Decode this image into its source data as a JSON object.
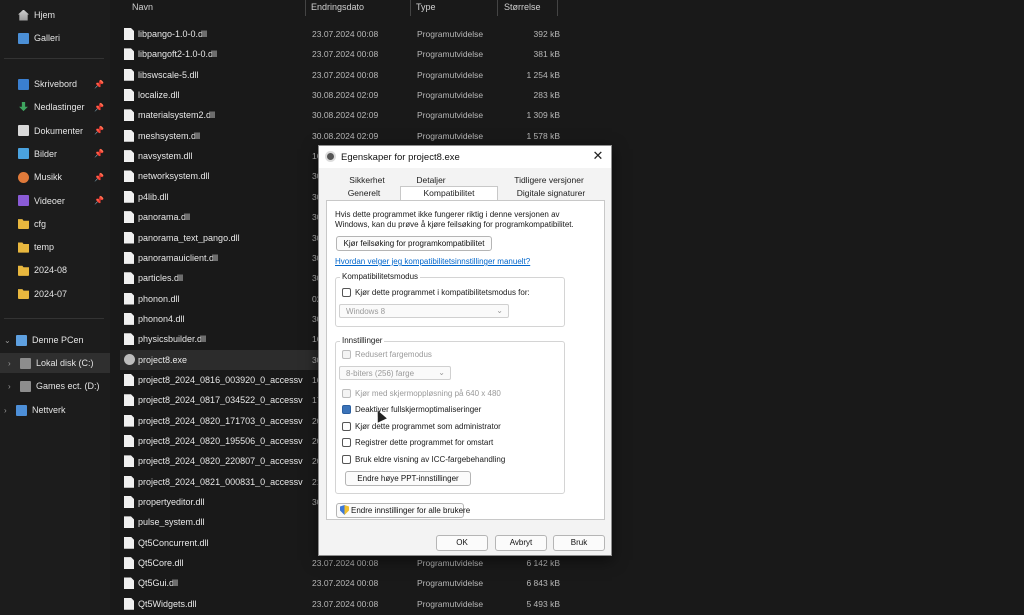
{
  "nav": {
    "quick": [
      {
        "label": "Hjem",
        "icon": "home-icon"
      },
      {
        "label": "Galleri",
        "icon": "gallery-icon"
      }
    ],
    "pinned": [
      {
        "label": "Skrivebord",
        "icon": "desktop-icon",
        "pinned": true
      },
      {
        "label": "Nedlastinger",
        "icon": "downloads-icon",
        "pinned": true
      },
      {
        "label": "Dokumenter",
        "icon": "documents-icon",
        "pinned": true
      },
      {
        "label": "Bilder",
        "icon": "pictures-icon",
        "pinned": true
      },
      {
        "label": "Musikk",
        "icon": "music-icon",
        "pinned": true
      },
      {
        "label": "Videoer",
        "icon": "videos-icon",
        "pinned": true
      },
      {
        "label": "cfg",
        "icon": "folder-icon",
        "pinned": false
      },
      {
        "label": "temp",
        "icon": "folder-icon",
        "pinned": false
      },
      {
        "label": "2024-08",
        "icon": "folder-icon",
        "pinned": false
      },
      {
        "label": "2024-07",
        "icon": "folder-icon",
        "pinned": false
      }
    ],
    "tree": [
      {
        "label": "Denne PCen",
        "icon": "pc-icon",
        "chevron": "⌄"
      },
      {
        "label": "Lokal disk (C:)",
        "icon": "drive-icon",
        "chevron": "›"
      },
      {
        "label": "Games ect. (D:)",
        "icon": "drive-icon",
        "chevron": "›"
      },
      {
        "label": "Nettverk",
        "icon": "network-icon",
        "chevron": "›"
      }
    ],
    "pin_glyph": "📌"
  },
  "files": {
    "columns": {
      "name": "Navn",
      "date": "Endringsdato",
      "type": "Type",
      "size": "Størrelse"
    },
    "rows": [
      {
        "name": "libpango-1.0-0.dll",
        "date": "23.07.2024 00:08",
        "type": "Programutvidelse",
        "size": "392 kB"
      },
      {
        "name": "libpangoft2-1.0-0.dll",
        "date": "23.07.2024 00:08",
        "type": "Programutvidelse",
        "size": "381 kB"
      },
      {
        "name": "libswscale-5.dll",
        "date": "23.07.2024 00:08",
        "type": "Programutvidelse",
        "size": "1 254 kB"
      },
      {
        "name": "localize.dll",
        "date": "30.08.2024 02:09",
        "type": "Programutvidelse",
        "size": "283 kB"
      },
      {
        "name": "materialsystem2.dll",
        "date": "30.08.2024 02:09",
        "type": "Programutvidelse",
        "size": "1 309 kB"
      },
      {
        "name": "meshsystem.dll",
        "date": "30.08.2024 02:09",
        "type": "Programutvidelse",
        "size": "1 578 kB"
      },
      {
        "name": "navsystem.dll",
        "date": "16",
        "type": "",
        "size": ""
      },
      {
        "name": "networksystem.dll",
        "date": "30",
        "type": "",
        "size": ""
      },
      {
        "name": "p4lib.dll",
        "date": "30",
        "type": "",
        "size": ""
      },
      {
        "name": "panorama.dll",
        "date": "30",
        "type": "",
        "size": ""
      },
      {
        "name": "panorama_text_pango.dll",
        "date": "30",
        "type": "",
        "size": ""
      },
      {
        "name": "panoramauiclient.dll",
        "date": "30",
        "type": "",
        "size": ""
      },
      {
        "name": "particles.dll",
        "date": "30",
        "type": "",
        "size": ""
      },
      {
        "name": "phonon.dll",
        "date": "02",
        "type": "",
        "size": ""
      },
      {
        "name": "phonon4.dll",
        "date": "30",
        "type": "",
        "size": ""
      },
      {
        "name": "physicsbuilder.dll",
        "date": "16",
        "type": "",
        "size": ""
      },
      {
        "name": "project8.exe",
        "date": "30",
        "type": "",
        "size": "",
        "exe": true,
        "selected": true
      },
      {
        "name": "project8_2024_0816_003920_0_accessviola...",
        "date": "16",
        "type": "",
        "size": ""
      },
      {
        "name": "project8_2024_0817_034522_0_accessviola...",
        "date": "17",
        "type": "",
        "size": ""
      },
      {
        "name": "project8_2024_0820_171703_0_accessviola...",
        "date": "20",
        "type": "",
        "size": ""
      },
      {
        "name": "project8_2024_0820_195506_0_accessviola...",
        "date": "20",
        "type": "",
        "size": ""
      },
      {
        "name": "project8_2024_0820_220807_0_accessviola...",
        "date": "20",
        "type": "",
        "size": ""
      },
      {
        "name": "project8_2024_0821_000831_0_accessviola...",
        "date": "21",
        "type": "",
        "size": ""
      },
      {
        "name": "propertyeditor.dll",
        "date": "30",
        "type": "",
        "size": ""
      },
      {
        "name": "pulse_system.dll",
        "date": "",
        "type": "",
        "size": ""
      },
      {
        "name": "Qt5Concurrent.dll",
        "date": "",
        "type": "",
        "size": ""
      },
      {
        "name": "Qt5Core.dll",
        "date": "23.07.2024 00:08",
        "type": "Programutvidelse",
        "size": "6 142 kB"
      },
      {
        "name": "Qt5Gui.dll",
        "date": "23.07.2024 00:08",
        "type": "Programutvidelse",
        "size": "6 843 kB"
      },
      {
        "name": "Qt5Widgets.dll",
        "date": "23.07.2024 00:08",
        "type": "Programutvidelse",
        "size": "5 493 kB"
      }
    ]
  },
  "dialog": {
    "title": "Egenskaper for project8.exe",
    "close_glyph": "✕",
    "tabs_row1": [
      "Sikkerhet",
      "Detaljer",
      "Tidligere versjoner"
    ],
    "tabs_row2": [
      "Generelt",
      "Kompatibilitet",
      "Digitale signaturer"
    ],
    "intro_line1": "Hvis dette programmet ikke fungerer riktig i denne versjonen av",
    "intro_line2": "Windows, kan du prøve å kjøre feilsøking for programkompatibilitet.",
    "troubleshoot_button": "Kjør feilsøking for programkompatibilitet",
    "manual_link": "Hvordan velger jeg kompatibilitetsinnstillinger manuelt?",
    "compat_group": "Kompatibilitetsmodus",
    "compat_checkbox": "Kjør dette programmet i kompatibilitetsmodus for:",
    "compat_select": "Windows 8",
    "settings_group": "Innstillinger",
    "reduced_color": "Redusert fargemodus",
    "color_select": "8-biters (256) farge",
    "res_640": "Kjør med skjermoppløsning på 640 x 480",
    "disable_fullscreen": "Deaktiver fullskjermoptimaliseringer",
    "run_admin": "Kjør dette programmet som administrator",
    "register_restart": "Registrer dette programmet for omstart",
    "legacy_icc": "Bruk eldre visning av ICC-fargebehandling",
    "dpi_button": "Endre høye PPT-innstillinger",
    "all_users_button": "Endre innstillinger for alle brukere",
    "ok": "OK",
    "cancel": "Avbryt",
    "apply": "Bruk",
    "chevron": "⌄"
  }
}
